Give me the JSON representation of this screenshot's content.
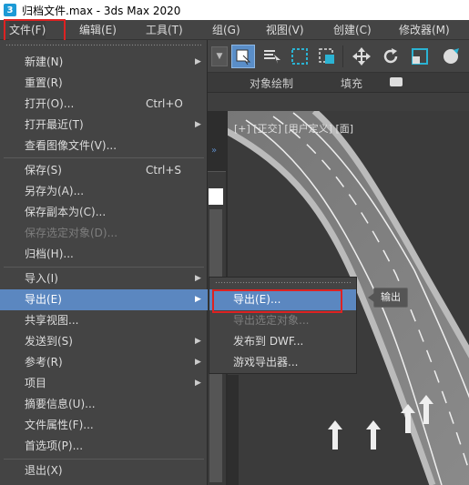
{
  "window": {
    "title": "归档文件.max - 3ds Max 2020",
    "icon_label": "3"
  },
  "menubar": {
    "items": [
      {
        "label": "文件(F)"
      },
      {
        "label": "编辑(E)"
      },
      {
        "label": "工具(T)"
      },
      {
        "label": "组(G)"
      },
      {
        "label": "视图(V)"
      },
      {
        "label": "创建(C)"
      },
      {
        "label": "修改器(M)"
      }
    ]
  },
  "ribbon": {
    "object_paint": "对象绘制",
    "fill": "填充"
  },
  "viewport": {
    "label": "[+] [正交] [用户定义] [面]"
  },
  "file_menu": {
    "items": [
      {
        "label": "新建(N)",
        "shortcut": "",
        "has_submenu": true,
        "disabled": false
      },
      {
        "label": "重置(R)",
        "shortcut": "",
        "has_submenu": false,
        "disabled": false
      },
      {
        "label": "打开(O)...",
        "shortcut": "Ctrl+O",
        "has_submenu": false,
        "disabled": false
      },
      {
        "label": "打开最近(T)",
        "shortcut": "",
        "has_submenu": true,
        "disabled": false
      },
      {
        "label": "查看图像文件(V)...",
        "shortcut": "",
        "has_submenu": false,
        "disabled": false
      },
      {
        "label": "保存(S)",
        "shortcut": "Ctrl+S",
        "has_submenu": false,
        "disabled": false
      },
      {
        "label": "另存为(A)...",
        "shortcut": "",
        "has_submenu": false,
        "disabled": false
      },
      {
        "label": "保存副本为(C)...",
        "shortcut": "",
        "has_submenu": false,
        "disabled": false
      },
      {
        "label": "保存选定对象(D)...",
        "shortcut": "",
        "has_submenu": false,
        "disabled": true
      },
      {
        "label": "归档(H)...",
        "shortcut": "",
        "has_submenu": false,
        "disabled": false
      },
      {
        "label": "导入(I)",
        "shortcut": "",
        "has_submenu": true,
        "disabled": false
      },
      {
        "label": "导出(E)",
        "shortcut": "",
        "has_submenu": true,
        "disabled": false,
        "highlighted": true
      },
      {
        "label": "共享视图...",
        "shortcut": "",
        "has_submenu": false,
        "disabled": false
      },
      {
        "label": "发送到(S)",
        "shortcut": "",
        "has_submenu": true,
        "disabled": false
      },
      {
        "label": "参考(R)",
        "shortcut": "",
        "has_submenu": true,
        "disabled": false
      },
      {
        "label": "项目",
        "shortcut": "",
        "has_submenu": true,
        "disabled": false
      },
      {
        "label": "摘要信息(U)...",
        "shortcut": "",
        "has_submenu": false,
        "disabled": false
      },
      {
        "label": "文件属性(F)...",
        "shortcut": "",
        "has_submenu": false,
        "disabled": false
      },
      {
        "label": "首选项(P)...",
        "shortcut": "",
        "has_submenu": false,
        "disabled": false
      },
      {
        "label": "退出(X)",
        "shortcut": "",
        "has_submenu": false,
        "disabled": false
      }
    ]
  },
  "export_submenu": {
    "items": [
      {
        "label": "导出(E)...",
        "disabled": false,
        "highlighted": true
      },
      {
        "label": "导出选定对象...",
        "disabled": true
      },
      {
        "label": "发布到 DWF...",
        "disabled": false
      },
      {
        "label": "游戏导出器...",
        "disabled": false
      }
    ]
  },
  "tooltip": {
    "text": "输出"
  },
  "colors": {
    "highlight": "#5b87c0",
    "annotation": "#d22222",
    "menu_bg": "#444444"
  }
}
